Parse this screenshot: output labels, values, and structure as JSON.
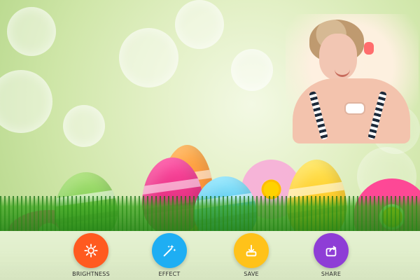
{
  "toolbar": {
    "items": [
      {
        "label": "BRIGHTNESS",
        "icon": "sun-icon",
        "color": "#ff5a20"
      },
      {
        "label": "EFFECT",
        "icon": "magic-wand-icon",
        "color": "#1eaef3"
      },
      {
        "label": "SAVE",
        "icon": "download-icon",
        "color": "#ffc21a"
      },
      {
        "label": "SHARE",
        "icon": "share-icon",
        "color": "#8e3dd6"
      }
    ]
  }
}
